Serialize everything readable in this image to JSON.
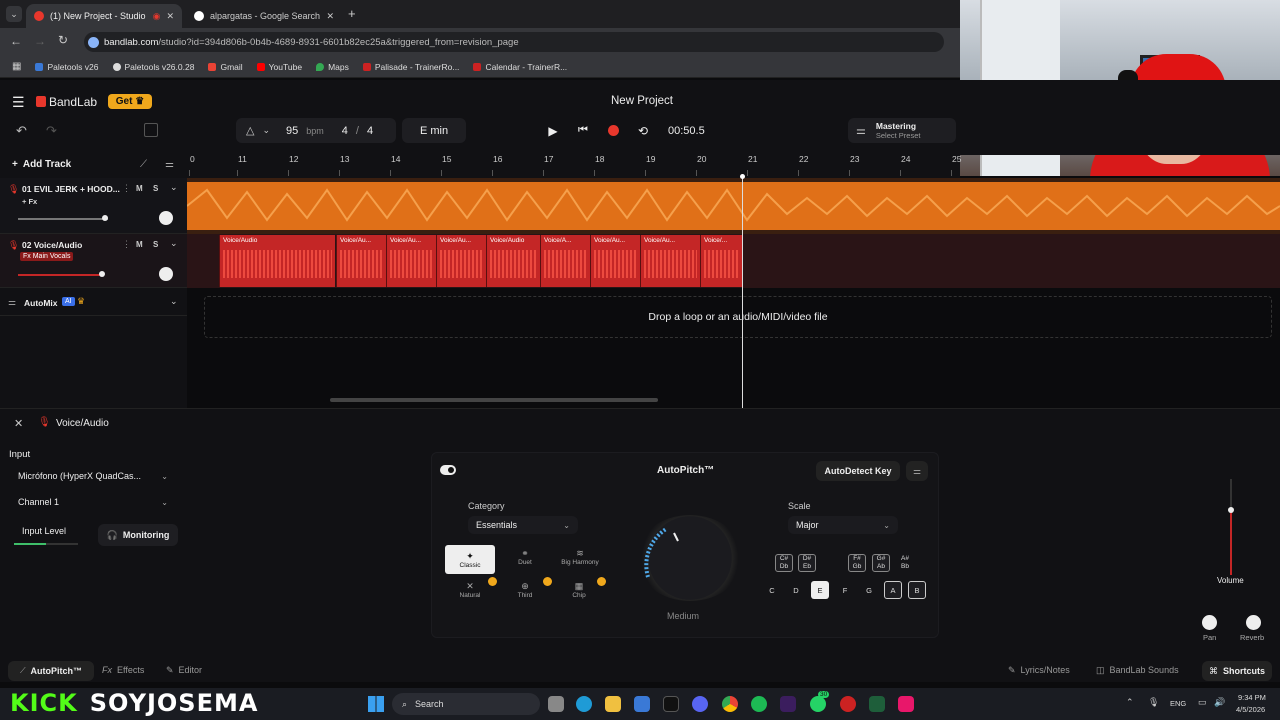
{
  "browser": {
    "tabs": [
      {
        "title": "(1) New Project - Studio",
        "active": true
      },
      {
        "title": "alpargatas - Google Search",
        "active": false
      }
    ],
    "url_domain": "bandlab.com",
    "url_path": "/studio?id=394d806b-0b4b-4689-8931-6601b82ec25a&triggered_from=revision_page",
    "bookmarks": [
      {
        "label": "Paletools v26",
        "color": "#3a79d6"
      },
      {
        "label": "Paletools v26.0.28",
        "color": "#dddddd"
      },
      {
        "label": "Gmail",
        "color": "#ea4335"
      },
      {
        "label": "YouTube",
        "color": "#ff0000"
      },
      {
        "label": "Maps",
        "color": "#34a853"
      },
      {
        "label": "Palisade - TrainerRo...",
        "color": "#cc2222"
      },
      {
        "label": "Calendar - TrainerR...",
        "color": "#cc2222"
      }
    ]
  },
  "app": {
    "brand": "BandLab",
    "get_label": "Get",
    "project_title": "New Project",
    "tempo": "95",
    "tempo_unit": "bpm",
    "time_sig_num": "4",
    "time_sig_sep": "/",
    "time_sig_den": "4",
    "key": "E min",
    "time": "00:50.5",
    "mastering_title": "Mastering",
    "mastering_sub": "Select Preset",
    "accent": "#e8372c",
    "orange": "#f07a1c"
  },
  "tracks": {
    "add_label": "Add Track",
    "ruler": [
      "0",
      "11",
      "12",
      "13",
      "14",
      "15",
      "16",
      "17",
      "18",
      "19",
      "20",
      "21",
      "22",
      "23",
      "24",
      "25"
    ],
    "list": [
      {
        "name": "01  EVIL JERK + HOOD...",
        "tag": "+ Fx",
        "m": "M",
        "s": "S"
      },
      {
        "name": "02  Voice/Audio",
        "tag": "Fx Main Vocals",
        "m": "M",
        "s": "S"
      }
    ],
    "automix": "AutoMix",
    "ai": "AI",
    "clips": [
      "Voice/Audio",
      "Voice/Au...",
      "Voice/Au...",
      "Voice/Au...",
      "Voice/Audio",
      "Voice/A...",
      "Voice/Au...",
      "Voice/Au...",
      "Voice/..."
    ],
    "drop_text": "Drop a loop or an audio/MIDI/video file"
  },
  "panel": {
    "title": "Voice/Audio",
    "input_label": "Input",
    "input_device": "Micrófono (HyperX QuadCas...",
    "channel": "Channel 1",
    "input_level": "Input Level",
    "monitoring": "Monitoring",
    "autopitch_title": "AutoPitch™",
    "autodetect": "AutoDetect Key",
    "category_label": "Category",
    "category_value": "Essentials",
    "presets": [
      "Classic",
      "Duet",
      "Big Harmony",
      "Natural",
      "Third",
      "Chip"
    ],
    "dial_label": "Medium",
    "scale_label": "Scale",
    "scale_value": "Major",
    "sharps": [
      {
        "top": "C#",
        "bot": "Db"
      },
      {
        "top": "D#",
        "bot": "Eb"
      },
      {
        "top": "F#",
        "bot": "Gb"
      },
      {
        "top": "G#",
        "bot": "Ab"
      },
      {
        "top": "A#",
        "bot": "Bb"
      }
    ],
    "naturals": [
      "C",
      "D",
      "E",
      "F",
      "G",
      "A",
      "B"
    ],
    "volume_label": "Volume",
    "pan_label": "Pan",
    "reverb_label": "Reverb"
  },
  "footer": {
    "autopitch": "AutoPitch™",
    "effects": "Effects",
    "editor": "Editor",
    "lyrics": "Lyrics/Notes",
    "sounds": "BandLab Sounds",
    "shortcuts": "Shortcuts"
  },
  "overlay": {
    "kick": "KICK",
    "handle": "SOYJOSEMA"
  },
  "taskbar": {
    "search": "Search",
    "lang": "ENG",
    "time": "9:34 PM",
    "date": "4/5/2026",
    "badge": "30"
  }
}
